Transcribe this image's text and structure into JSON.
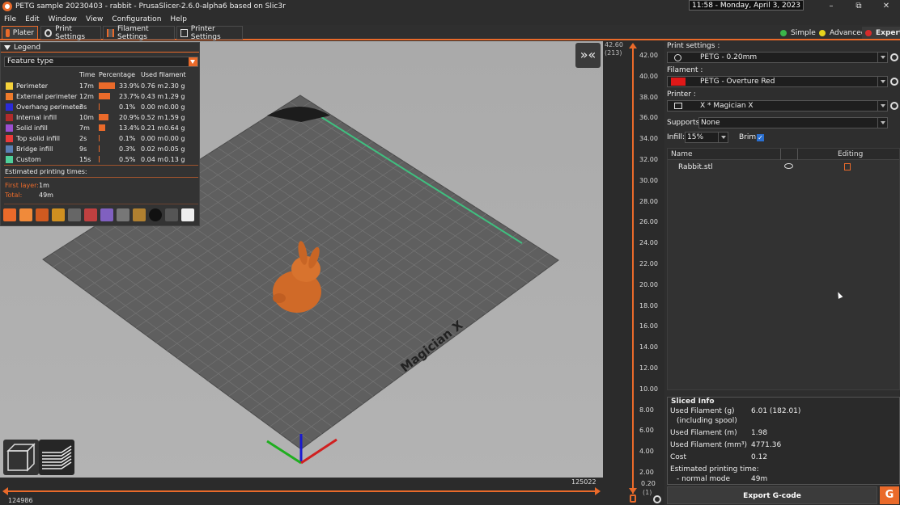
{
  "window": {
    "title": "PETG sample 20230403 - rabbit - PrusaSlicer-2.6.0-alpha6 based on Slic3r",
    "clock": "11:58 - Monday, April 3, 2023",
    "min": "–",
    "restore": "⧉",
    "close": "✕"
  },
  "menu": [
    "File",
    "Edit",
    "Window",
    "View",
    "Configuration",
    "Help"
  ],
  "tabs": [
    {
      "label": "Plater",
      "icon": "plater-icon",
      "active": true
    },
    {
      "label": "Print Settings",
      "icon": "gear-icon"
    },
    {
      "label": "Filament Settings",
      "icon": "spool-icon"
    },
    {
      "label": "Printer Settings",
      "icon": "printer-icon"
    }
  ],
  "modes": [
    {
      "label": "Simple",
      "color": "#3bb54a"
    },
    {
      "label": "Advanced",
      "color": "#e6d31c"
    },
    {
      "label": "Expert",
      "color": "#d62b2b",
      "active": true
    }
  ],
  "legend": {
    "title": "Legend",
    "select": "Feature type",
    "columns": {
      "time": "Time",
      "percentage": "Percentage",
      "used": "Used filament"
    },
    "rows": [
      {
        "name": "Perimeter",
        "color": "#f5d23a",
        "time": "17m",
        "pct": "33.9%",
        "len": "0.76 m",
        "weight": "2.30 g",
        "frac": 0.339
      },
      {
        "name": "External perimeter",
        "color": "#ef7a2b",
        "time": "12m",
        "pct": "23.7%",
        "len": "0.43 m",
        "weight": "1.29 g",
        "frac": 0.237
      },
      {
        "name": "Overhang perimeter",
        "color": "#2b2bd8",
        "time": "3s",
        "pct": "0.1%",
        "len": "0.00 m",
        "weight": "0.00 g",
        "frac": 0.001
      },
      {
        "name": "Internal infill",
        "color": "#b02b2b",
        "time": "10m",
        "pct": "20.9%",
        "len": "0.52 m",
        "weight": "1.59 g",
        "frac": 0.209
      },
      {
        "name": "Solid infill",
        "color": "#9b4fd0",
        "time": "7m",
        "pct": "13.4%",
        "len": "0.21 m",
        "weight": "0.64 g",
        "frac": 0.134
      },
      {
        "name": "Top solid infill",
        "color": "#ea3a3a",
        "time": "2s",
        "pct": "0.1%",
        "len": "0.00 m",
        "weight": "0.00 g",
        "frac": 0.001
      },
      {
        "name": "Bridge infill",
        "color": "#5a7fb5",
        "time": "9s",
        "pct": "0.3%",
        "len": "0.02 m",
        "weight": "0.05 g",
        "frac": 0.003
      },
      {
        "name": "Custom",
        "color": "#4fd09a",
        "time": "15s",
        "pct": "0.5%",
        "len": "0.04 m",
        "weight": "0.13 g",
        "frac": 0.005
      }
    ],
    "estimated_label": "Estimated printing times:",
    "first_layer_label": "First layer:",
    "first_layer_value": "1m",
    "total_label": "Total:",
    "total_value": "49m"
  },
  "viewport": {
    "bed_label": "Magician X",
    "collapse": "»«"
  },
  "hslider": {
    "left_value": "124986",
    "right_value": "125022"
  },
  "vslider": {
    "top_value": "42.60",
    "top_layer": "(213)",
    "bottom_value": "0.20",
    "bottom_layer": "(1)",
    "ticks": [
      "42.00",
      "40.00",
      "38.00",
      "36.00",
      "34.00",
      "32.00",
      "30.00",
      "28.00",
      "26.00",
      "24.00",
      "22.00",
      "20.00",
      "18.00",
      "16.00",
      "14.00",
      "12.00",
      "10.00",
      "8.00",
      "6.00",
      "4.00",
      "2.00"
    ]
  },
  "sidebar": {
    "print_settings_label": "Print settings :",
    "print_settings_value": "PETG - 0.20mm",
    "filament_label": "Filament :",
    "filament_value": "PETG - Overture Red",
    "filament_color": "#e01818",
    "printer_label": "Printer :",
    "printer_value": "X * Magician X",
    "supports_label": "Supports:",
    "supports_value": "None",
    "infill_label": "Infill:",
    "infill_value": "15%",
    "brim_label": "Brim:",
    "brim_checked": true,
    "list_name_header": "Name",
    "list_editing_header": "Editing",
    "objects": [
      {
        "name": "Rabbit.stl"
      }
    ],
    "sliced_info_title": "Sliced Info",
    "sliced_info": [
      {
        "label": "Used Filament (g)",
        "value": "6.01 (182.01)"
      },
      {
        "label": "(including spool)",
        "value": ""
      },
      {
        "label": "Used Filament (m)",
        "value": "1.98"
      },
      {
        "label": "Used Filament (mm³)",
        "value": "4771.36"
      },
      {
        "label": "Cost",
        "value": "0.12"
      },
      {
        "label": "Estimated printing time:",
        "value": ""
      },
      {
        "label": "- normal mode",
        "value": "49m"
      }
    ],
    "export_label": "Export G-code",
    "gcode_button": "G"
  }
}
